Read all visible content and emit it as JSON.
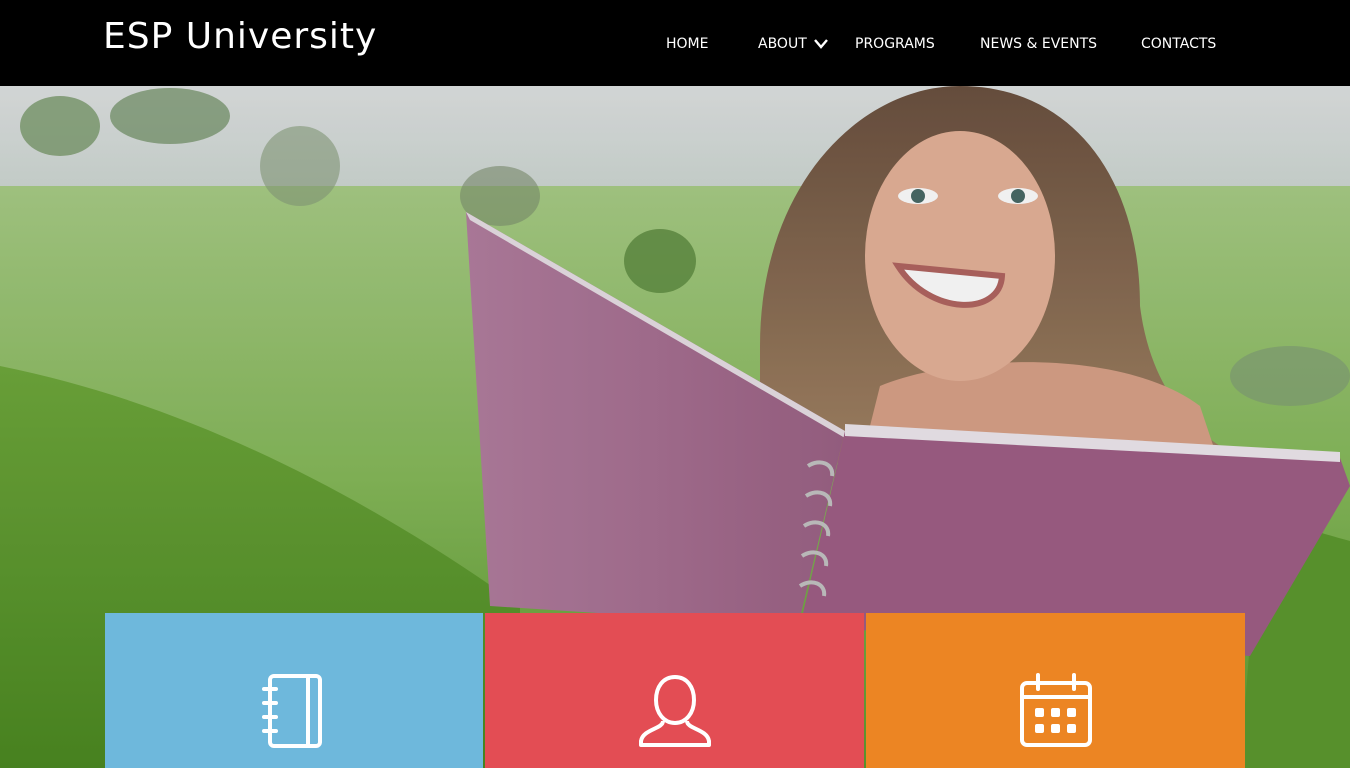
{
  "header": {
    "logo": "ESP University",
    "nav": [
      {
        "label": "HOME"
      },
      {
        "label": "ABOUT",
        "has_dropdown": true
      },
      {
        "label": "PROGRAMS"
      },
      {
        "label": "NEWS & EVENTS"
      },
      {
        "label": "CONTACTS"
      }
    ]
  },
  "slider": {
    "slide_count": 3,
    "active_slide": 3
  },
  "tiles": [
    {
      "icon": "notebook-icon",
      "color": "#6eb8dc"
    },
    {
      "icon": "user-icon",
      "color": "#e34d54"
    },
    {
      "icon": "calendar-icon",
      "color": "#ec8523"
    }
  ],
  "colors": {
    "header_bg": "#000000",
    "accent_dot": "#72bde8"
  }
}
